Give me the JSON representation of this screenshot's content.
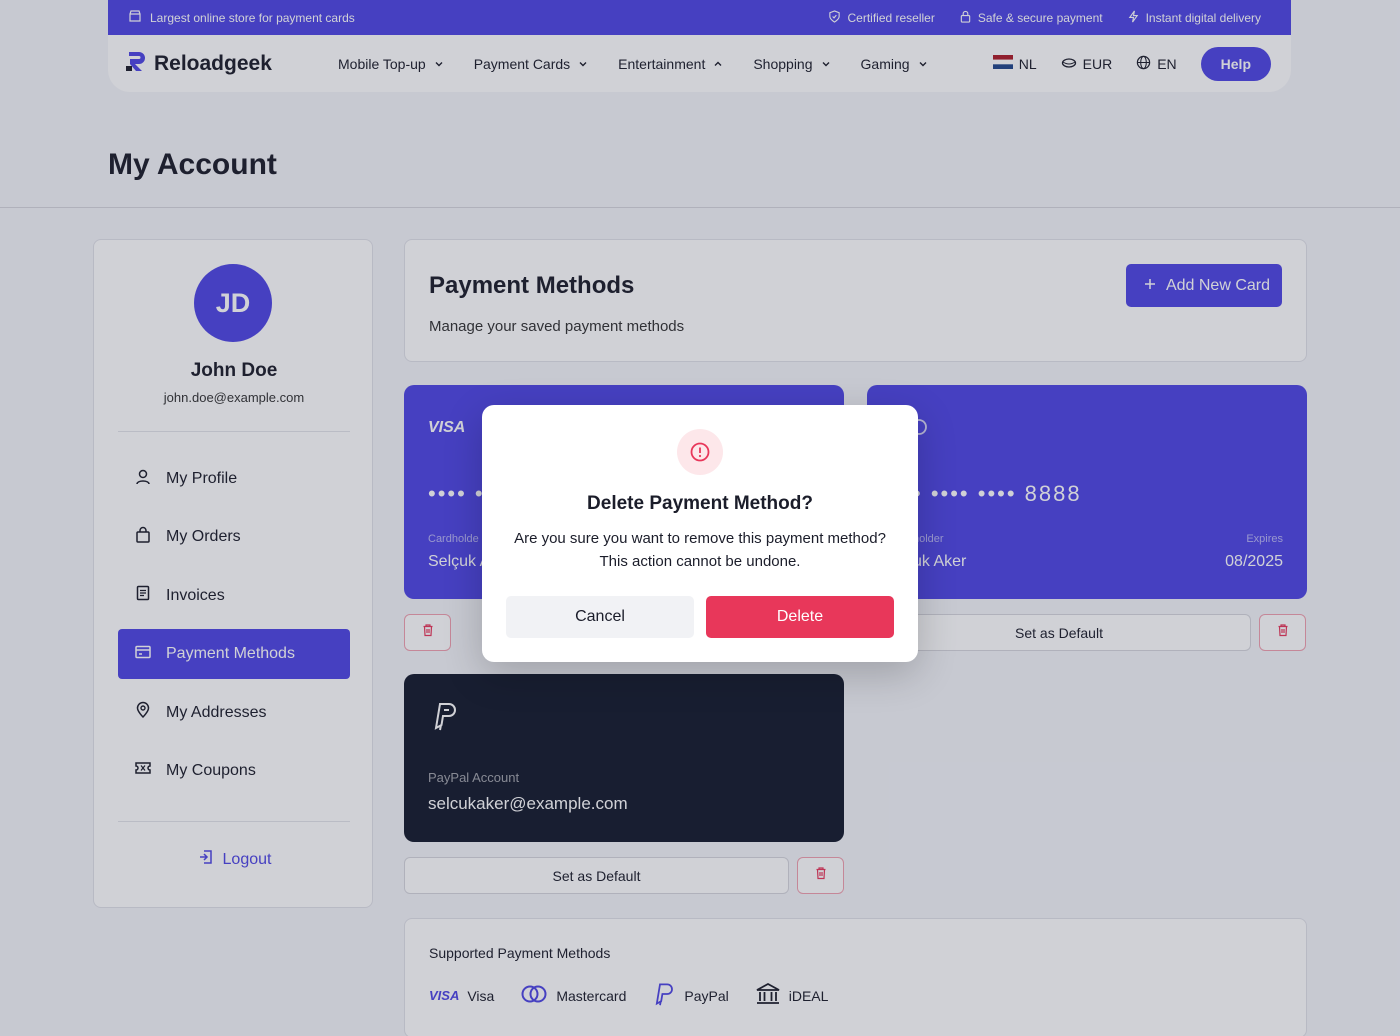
{
  "topbar": {
    "tagline": "Largest online store for payment cards",
    "certified": "Certified reseller",
    "secure": "Safe & secure payment",
    "delivery": "Instant digital delivery"
  },
  "navbar": {
    "logo": "Reloadgeek",
    "menu": [
      "Mobile Top-up",
      "Payment Cards",
      "Entertainment",
      "Shopping",
      "Gaming"
    ],
    "country": "NL",
    "currency": "EUR",
    "language": "EN",
    "help": "Help"
  },
  "page": {
    "title": "My Account"
  },
  "sidebar": {
    "initials": "JD",
    "name": "John Doe",
    "email": "john.doe@example.com",
    "items": [
      {
        "label": "My Profile",
        "icon": "user-icon"
      },
      {
        "label": "My Orders",
        "icon": "bag-icon"
      },
      {
        "label": "Invoices",
        "icon": "document-icon"
      },
      {
        "label": "Payment Methods",
        "icon": "credit-card-icon"
      },
      {
        "label": "My Addresses",
        "icon": "map-pin-icon"
      },
      {
        "label": "My Coupons",
        "icon": "ticket-icon"
      }
    ],
    "logout": "Logout"
  },
  "payment": {
    "title": "Payment Methods",
    "subtitle": "Manage your saved payment methods",
    "add_button": "Add New Card",
    "cards": {
      "visa": {
        "brand": "VISA",
        "number": "•••• ••",
        "holder_label": "Cardholde",
        "holder": "Selçuk A"
      },
      "mc": {
        "number": "• •••• •••• 8888",
        "holder_label": "nolder",
        "holder": "uk Aker",
        "expires_label": "Expires",
        "expires": "08/2025",
        "set_default": "Set as Default"
      },
      "paypal": {
        "label": "PayPal Account",
        "email": "selcukaker@example.com",
        "set_default": "Set as Default"
      }
    }
  },
  "supported": {
    "title": "Supported Payment Methods",
    "visa_mark": "VISA",
    "items": [
      "Visa",
      "Mastercard",
      "PayPal",
      "iDEAL"
    ]
  },
  "modal": {
    "title": "Delete Payment Method?",
    "body_line1": "Are you sure you want to remove this payment method?",
    "body_line2": "This action cannot be undone.",
    "cancel": "Cancel",
    "delete": "Delete"
  },
  "colors": {
    "primary": "#4f46e5",
    "danger": "#e8375a",
    "dark_card": "#141a2c"
  }
}
